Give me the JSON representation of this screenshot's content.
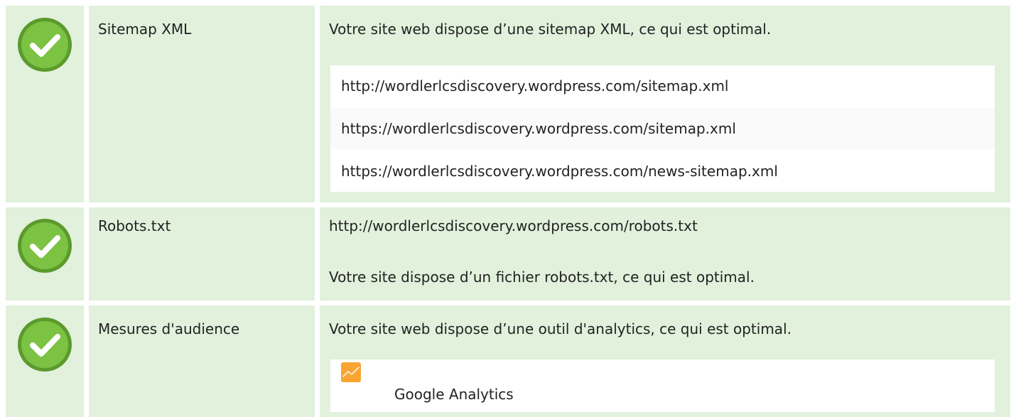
{
  "colors": {
    "row_background": "#e1f1dc",
    "check_green": "#7cc243",
    "check_ring": "#5b9a2c",
    "analytics_orange": "#f9a531"
  },
  "rows": [
    {
      "icon": "check-circle-icon",
      "label": "Sitemap XML",
      "message": "Votre site web dispose d’une sitemap XML, ce qui est optimal.",
      "urls": [
        "http://wordlerlcsdiscovery.wordpress.com/sitemap.xml",
        "https://wordlerlcsdiscovery.wordpress.com/sitemap.xml",
        "https://wordlerlcsdiscovery.wordpress.com/news-sitemap.xml"
      ]
    },
    {
      "icon": "check-circle-icon",
      "label": "Robots.txt",
      "url": "http://wordlerlcsdiscovery.wordpress.com/robots.txt",
      "message": "Votre site dispose d’un fichier robots.txt, ce qui est optimal."
    },
    {
      "icon": "check-circle-icon",
      "label": "Mesures d'audience",
      "message": "Votre site web dispose d’une outil d'analytics, ce qui est optimal.",
      "tools": [
        {
          "icon": "google-analytics-icon",
          "name": "Google Analytics"
        }
      ]
    }
  ]
}
